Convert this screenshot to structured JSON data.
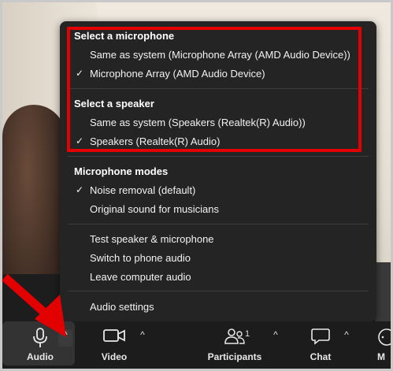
{
  "microphone_section": {
    "title": "Select a microphone",
    "items": [
      {
        "label": "Same as system (Microphone Array (AMD Audio Device))",
        "checked": false
      },
      {
        "label": "Microphone Array (AMD Audio Device)",
        "checked": true
      }
    ]
  },
  "speaker_section": {
    "title": "Select a speaker",
    "items": [
      {
        "label": "Same as system (Speakers (Realtek(R) Audio))",
        "checked": false
      },
      {
        "label": "Speakers (Realtek(R) Audio)",
        "checked": true
      }
    ]
  },
  "modes_section": {
    "title": "Microphone modes",
    "items": [
      {
        "label": "Noise removal (default)",
        "checked": true
      },
      {
        "label": "Original sound for musicians",
        "checked": false
      }
    ]
  },
  "actions": {
    "test": "Test speaker & microphone",
    "phone": "Switch to phone audio",
    "leave": "Leave computer audio"
  },
  "settings": "Audio settings",
  "check_glyph": "✓",
  "caret_glyph": "^",
  "toolbar": {
    "audio": "Audio",
    "video": "Video",
    "participants": "Participants",
    "participants_count": "1",
    "chat": "Chat",
    "more": "M"
  },
  "colors": {
    "highlight_box": "#e30000",
    "arrow": "#e30000",
    "menu_bg": "#242424",
    "toolbar_bg": "#1c1c1c"
  }
}
